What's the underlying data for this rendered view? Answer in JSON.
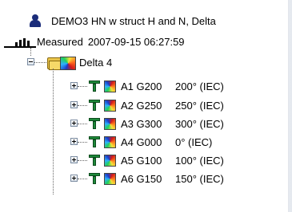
{
  "tree": {
    "root": {
      "label": "DEMO3 HN w struct  H and N, Delta",
      "icon": "person-icon"
    },
    "measurement": {
      "label": "Measured",
      "timestamp": "2007-09-15 06:27:59",
      "icon": "bars-icon"
    },
    "group": {
      "label": "Delta 4",
      "icon": "folder-map-icon",
      "expanded": true
    },
    "children": [
      {
        "name": "A1 G200",
        "angle": "200° (IEC)"
      },
      {
        "name": "A2 G250",
        "angle": "250° (IEC)"
      },
      {
        "name": "A3 G300",
        "angle": "300° (IEC)"
      },
      {
        "name": "A4 G000",
        "angle": "0° (IEC)"
      },
      {
        "name": "A5 G100",
        "angle": "100° (IEC)"
      },
      {
        "name": "A6 G150",
        "angle": "150° (IEC)"
      }
    ]
  }
}
